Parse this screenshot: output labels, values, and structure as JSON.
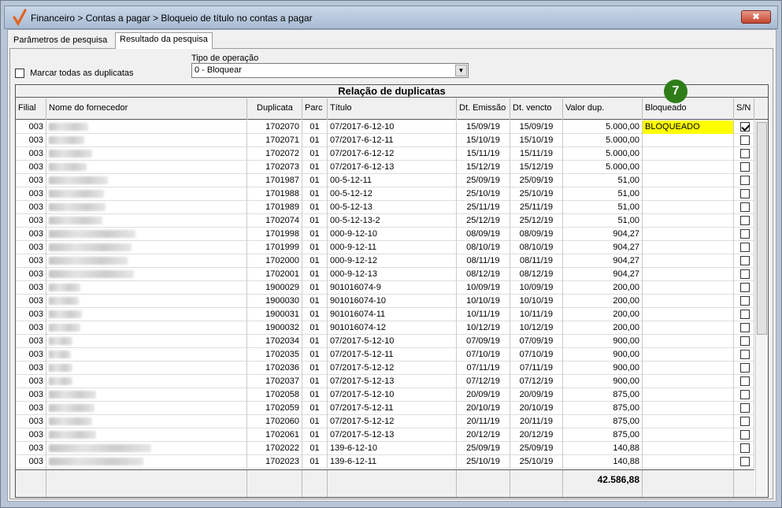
{
  "window": {
    "title": "Financeiro > Contas a pagar > Bloqueio de título no contas a pagar",
    "close_label": "✖"
  },
  "tabs": [
    {
      "label": "Parâmetros de pesquisa"
    },
    {
      "label": "Resultado da pesquisa"
    }
  ],
  "mark_all_label": "Marcar todas as duplicatas",
  "operation": {
    "label": "Tipo de operação",
    "value": "0 - Bloquear"
  },
  "grid": {
    "title": "Relação de duplicatas",
    "columns": {
      "filial": "Filial",
      "fornecedor": "Nome do fornecedor",
      "duplicata": "Duplicata",
      "parc": "Parc",
      "titulo": "Título",
      "emissao": "Dt. Emissão",
      "vencto": "Dt. vencto",
      "valor": "Valor dup.",
      "bloqueado": "Bloqueado",
      "sn": "S/N"
    },
    "rows": [
      {
        "filial": "003",
        "duplicata": "1702070",
        "parc": "01",
        "titulo": "07/2017-6-12-10",
        "emissao": "15/09/19",
        "vencto": "15/09/19",
        "valor": "5.000,00",
        "bloqueado": "BLOQUEADO",
        "checked": true
      },
      {
        "filial": "003",
        "duplicata": "1702071",
        "parc": "01",
        "titulo": "07/2017-6-12-11",
        "emissao": "15/10/19",
        "vencto": "15/10/19",
        "valor": "5.000,00",
        "bloqueado": "",
        "checked": false
      },
      {
        "filial": "003",
        "duplicata": "1702072",
        "parc": "01",
        "titulo": "07/2017-6-12-12",
        "emissao": "15/11/19",
        "vencto": "15/11/19",
        "valor": "5.000,00",
        "bloqueado": "",
        "checked": false
      },
      {
        "filial": "003",
        "duplicata": "1702073",
        "parc": "01",
        "titulo": "07/2017-6-12-13",
        "emissao": "15/12/19",
        "vencto": "15/12/19",
        "valor": "5.000,00",
        "bloqueado": "",
        "checked": false
      },
      {
        "filial": "003",
        "duplicata": "1701987",
        "parc": "01",
        "titulo": "00-5-12-11",
        "emissao": "25/09/19",
        "vencto": "25/09/19",
        "valor": "51,00",
        "bloqueado": "",
        "checked": false
      },
      {
        "filial": "003",
        "duplicata": "1701988",
        "parc": "01",
        "titulo": "00-5-12-12",
        "emissao": "25/10/19",
        "vencto": "25/10/19",
        "valor": "51,00",
        "bloqueado": "",
        "checked": false
      },
      {
        "filial": "003",
        "duplicata": "1701989",
        "parc": "01",
        "titulo": "00-5-12-13",
        "emissao": "25/11/19",
        "vencto": "25/11/19",
        "valor": "51,00",
        "bloqueado": "",
        "checked": false
      },
      {
        "filial": "003",
        "duplicata": "1702074",
        "parc": "01",
        "titulo": "00-5-12-13-2",
        "emissao": "25/12/19",
        "vencto": "25/12/19",
        "valor": "51,00",
        "bloqueado": "",
        "checked": false
      },
      {
        "filial": "003",
        "duplicata": "1701998",
        "parc": "01",
        "titulo": "000-9-12-10",
        "emissao": "08/09/19",
        "vencto": "08/09/19",
        "valor": "904,27",
        "bloqueado": "",
        "checked": false
      },
      {
        "filial": "003",
        "duplicata": "1701999",
        "parc": "01",
        "titulo": "000-9-12-11",
        "emissao": "08/10/19",
        "vencto": "08/10/19",
        "valor": "904,27",
        "bloqueado": "",
        "checked": false
      },
      {
        "filial": "003",
        "duplicata": "1702000",
        "parc": "01",
        "titulo": "000-9-12-12",
        "emissao": "08/11/19",
        "vencto": "08/11/19",
        "valor": "904,27",
        "bloqueado": "",
        "checked": false
      },
      {
        "filial": "003",
        "duplicata": "1702001",
        "parc": "01",
        "titulo": "000-9-12-13",
        "emissao": "08/12/19",
        "vencto": "08/12/19",
        "valor": "904,27",
        "bloqueado": "",
        "checked": false
      },
      {
        "filial": "003",
        "duplicata": "1900029",
        "parc": "01",
        "titulo": "901016074-9",
        "emissao": "10/09/19",
        "vencto": "10/09/19",
        "valor": "200,00",
        "bloqueado": "",
        "checked": false
      },
      {
        "filial": "003",
        "duplicata": "1900030",
        "parc": "01",
        "titulo": "901016074-10",
        "emissao": "10/10/19",
        "vencto": "10/10/19",
        "valor": "200,00",
        "bloqueado": "",
        "checked": false
      },
      {
        "filial": "003",
        "duplicata": "1900031",
        "parc": "01",
        "titulo": "901016074-11",
        "emissao": "10/11/19",
        "vencto": "10/11/19",
        "valor": "200,00",
        "bloqueado": "",
        "checked": false
      },
      {
        "filial": "003",
        "duplicata": "1900032",
        "parc": "01",
        "titulo": "901016074-12",
        "emissao": "10/12/19",
        "vencto": "10/12/19",
        "valor": "200,00",
        "bloqueado": "",
        "checked": false
      },
      {
        "filial": "003",
        "duplicata": "1702034",
        "parc": "01",
        "titulo": "07/2017-5-12-10",
        "emissao": "07/09/19",
        "vencto": "07/09/19",
        "valor": "900,00",
        "bloqueado": "",
        "checked": false
      },
      {
        "filial": "003",
        "duplicata": "1702035",
        "parc": "01",
        "titulo": "07/2017-5-12-11",
        "emissao": "07/10/19",
        "vencto": "07/10/19",
        "valor": "900,00",
        "bloqueado": "",
        "checked": false
      },
      {
        "filial": "003",
        "duplicata": "1702036",
        "parc": "01",
        "titulo": "07/2017-5-12-12",
        "emissao": "07/11/19",
        "vencto": "07/11/19",
        "valor": "900,00",
        "bloqueado": "",
        "checked": false
      },
      {
        "filial": "003",
        "duplicata": "1702037",
        "parc": "01",
        "titulo": "07/2017-5-12-13",
        "emissao": "07/12/19",
        "vencto": "07/12/19",
        "valor": "900,00",
        "bloqueado": "",
        "checked": false
      },
      {
        "filial": "003",
        "duplicata": "1702058",
        "parc": "01",
        "titulo": "07/2017-5-12-10",
        "emissao": "20/09/19",
        "vencto": "20/09/19",
        "valor": "875,00",
        "bloqueado": "",
        "checked": false
      },
      {
        "filial": "003",
        "duplicata": "1702059",
        "parc": "01",
        "titulo": "07/2017-5-12-11",
        "emissao": "20/10/19",
        "vencto": "20/10/19",
        "valor": "875,00",
        "bloqueado": "",
        "checked": false
      },
      {
        "filial": "003",
        "duplicata": "1702060",
        "parc": "01",
        "titulo": "07/2017-5-12-12",
        "emissao": "20/11/19",
        "vencto": "20/11/19",
        "valor": "875,00",
        "bloqueado": "",
        "checked": false
      },
      {
        "filial": "003",
        "duplicata": "1702061",
        "parc": "01",
        "titulo": "07/2017-5-12-13",
        "emissao": "20/12/19",
        "vencto": "20/12/19",
        "valor": "875,00",
        "bloqueado": "",
        "checked": false
      },
      {
        "filial": "003",
        "duplicata": "1702022",
        "parc": "01",
        "titulo": "139-6-12-10",
        "emissao": "25/09/19",
        "vencto": "25/09/19",
        "valor": "140,88",
        "bloqueado": "",
        "checked": false
      },
      {
        "filial": "003",
        "duplicata": "1702023",
        "parc": "01",
        "titulo": "139-6-12-11",
        "emissao": "25/10/19",
        "vencto": "25/10/19",
        "valor": "140,88",
        "bloqueado": "",
        "checked": false
      }
    ],
    "total": "42.586,88"
  },
  "step_badge": "7",
  "colors": {
    "accent": "#2e7d18",
    "highlight": "#ffff00"
  }
}
